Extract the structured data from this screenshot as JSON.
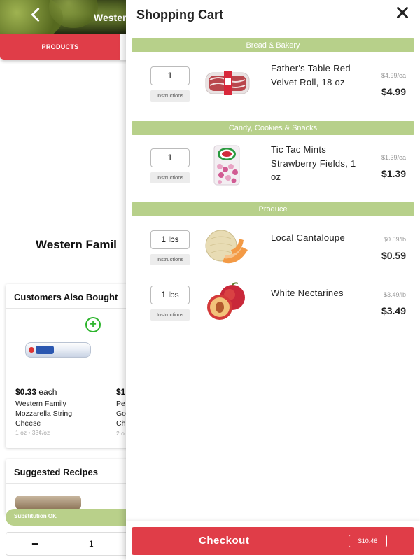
{
  "background": {
    "header_title": "Westerr",
    "tabs": {
      "products": "PRODUCTS"
    },
    "product_name": "Western Famil",
    "customers_also_bought": {
      "title": "Customers Also Bought",
      "items": [
        {
          "price": "$0.33",
          "price_suffix": " each",
          "name": "Western Family Mozzarella String Cheese",
          "meta": "1 oz • 33¢/oz"
        },
        {
          "price": "$1",
          "name": "Pe\nGo\nCh",
          "meta": "2 o"
        }
      ]
    },
    "suggested_recipes": {
      "title": "Suggested Recipes"
    },
    "substitution": {
      "label": "Substitution OK"
    },
    "quantity": {
      "minus": "−",
      "value": "1"
    }
  },
  "cart": {
    "title": "Shopping Cart",
    "sections": [
      {
        "name": "Bread & Bakery",
        "items": [
          {
            "qty": "1",
            "instructions": "Instructions",
            "name": "Father's Table Red Velvet Roll, 18 oz",
            "unit_price": "$4.99/ea",
            "total": "$4.99",
            "image": "red-velvet-roll"
          }
        ]
      },
      {
        "name": "Candy, Cookies & Snacks",
        "items": [
          {
            "qty": "1",
            "instructions": "Instructions",
            "name": "Tic Tac Mints Strawberry Fields, 1 oz",
            "unit_price": "$1.39/ea",
            "total": "$1.39",
            "image": "tic-tac"
          }
        ]
      },
      {
        "name": "Produce",
        "items": [
          {
            "qty": "1 lbs",
            "instructions": "Instructions",
            "name": "Local Cantaloupe",
            "unit_price": "$0.59/lb",
            "total": "$0.59",
            "image": "cantaloupe"
          },
          {
            "qty": "1 lbs",
            "instructions": "Instructions",
            "name": "White Nectarines",
            "unit_price": "$3.49/lb",
            "total": "$3.49",
            "image": "nectarine"
          }
        ]
      }
    ],
    "checkout": {
      "label": "Checkout",
      "total": "$10.46"
    }
  },
  "colors": {
    "accent_red": "#e03d48",
    "section_green": "#b7d08a",
    "add_green": "#2db52d"
  }
}
